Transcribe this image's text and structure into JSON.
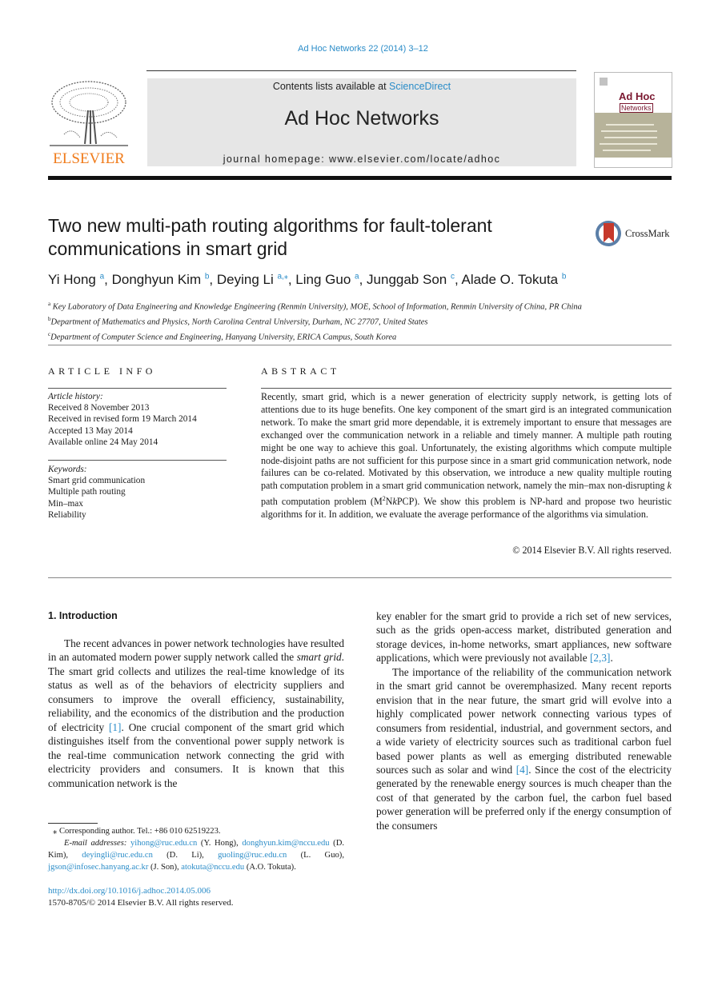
{
  "header": {
    "journal_ref": "Ad Hoc Networks 22 (2014) 3–12",
    "contents_prefix": "Contents lists available at ",
    "contents_link": "ScienceDirect",
    "journal_title": "Ad Hoc Networks",
    "homepage": "journal homepage: www.elsevier.com/locate/adhoc",
    "publisher_logo": "ELSEVIER",
    "cover_title_line1": "Ad Hoc",
    "cover_title_line2": "Networks",
    "colors": {
      "link": "#2a8cc8",
      "elsevier_orange": "#f07c1c",
      "masthead_bg": "#e6e6e6"
    }
  },
  "article": {
    "title": "Two new multi-path routing algorithms for fault-tolerant communications in smart grid",
    "crossmark_label": "CrossMark",
    "authors": [
      {
        "name": "Yi Hong",
        "sup": "a",
        "sep": ", "
      },
      {
        "name": "Donghyun Kim",
        "sup": "b",
        "sep": ", "
      },
      {
        "name": "Deying Li",
        "sup": "a,⁎",
        "sep": ", "
      },
      {
        "name": "Ling Guo",
        "sup": "a",
        "sep": ", "
      },
      {
        "name": "Junggab Son",
        "sup": "c",
        "sep": ", "
      },
      {
        "name": "Alade O. Tokuta",
        "sup": "b",
        "sep": ""
      }
    ],
    "affiliations": [
      {
        "sup": "a",
        "text": "Key Laboratory of Data Engineering and Knowledge Engineering (Renmin University), MOE, School of Information, Renmin University of China, PR China"
      },
      {
        "sup": "b",
        "text": "Department of Mathematics and Physics, North Carolina Central University, Durham, NC 27707, United States"
      },
      {
        "sup": "c",
        "text": "Department of Computer Science and Engineering, Hanyang University, ERICA Campus, South Korea"
      }
    ]
  },
  "article_info": {
    "heading": "ARTICLE INFO",
    "history_label": "Article history:",
    "history": [
      "Received 8 November 2013",
      "Received in revised form 19 March 2014",
      "Accepted 13 May 2014",
      "Available online 24 May 2014"
    ],
    "keywords_label": "Keywords:",
    "keywords": [
      "Smart grid communication",
      "Multiple path routing",
      "Min–max",
      "Reliability"
    ]
  },
  "abstract": {
    "heading": "ABSTRACT",
    "text_part1": "Recently, smart grid, which is a newer generation of electricity supply network, is getting lots of attentions due to its huge benefits. One key component of the smart gird is an integrated communication network. To make the smart grid more dependable, it is extremely important to ensure that messages are exchanged over the communication network in a reliable and timely manner. A multiple path routing might be one way to achieve this goal. Unfortunately, the existing algorithms which compute multiple node-disjoint paths are not sufficient for this purpose since in a smart grid communication network, node failures can be co-related. Motivated by this observation, we introduce a new quality multiple routing path computation problem in a smart grid communication network, namely the min–max non-disrupting ",
    "text_k": "k",
    "text_part2": " path computation problem (M",
    "text_sup": "2",
    "text_part3": "N",
    "text_k2": "k",
    "text_part4": "PCP). We show this problem is NP-hard and propose two heuristic algorithms for it. In addition, we evaluate the average performance of the algorithms via simulation.",
    "copyright": "© 2014 Elsevier B.V. All rights reserved."
  },
  "introduction": {
    "heading": "1. Introduction",
    "left_p1_a": "The recent advances in power network technologies have resulted in an automated modern power supply network called the ",
    "left_p1_em": "smart grid",
    "left_p1_b": ". The smart grid collects and utilizes the real-time knowledge of its status as well as of the behaviors of electricity suppliers and consumers to improve the overall efficiency, sustainability, reliability, and the economics of the distribution and the production of electricity ",
    "left_p1_ref": "[1]",
    "left_p1_c": ". One crucial component of the smart grid which distinguishes itself from the conventional power supply network is the real-time communication network connecting the grid with electricity providers and consumers. It is known that this communication network is the",
    "right_p1_a": "key enabler for the smart grid to provide a rich set of new services, such as the grids open-access market, distributed generation and storage devices, in-home networks, smart appliances, new software applications, which were previously not available ",
    "right_p1_ref": "[2,3]",
    "right_p1_b": ".",
    "right_p2_a": "The importance of the reliability of the communication network in the smart grid cannot be overemphasized. Many recent reports envision that in the near future, the smart grid will evolve into a highly complicated power network connecting various types of consumers from residential, industrial, and government sectors, and a wide variety of electricity sources such as traditional carbon fuel based power plants as well as emerging distributed renewable sources such as solar and wind ",
    "right_p2_ref": "[4]",
    "right_p2_b": ". Since the cost of the electricity generated by the renewable energy sources is much cheaper than the cost of that generated by the carbon fuel, the carbon fuel based power generation will be preferred only if the energy consumption of the consumers"
  },
  "footnotes": {
    "corresponding": "⁎ Corresponding author. Tel.: +86 010 62519223.",
    "email_label": "E-mail addresses: ",
    "emails": [
      {
        "email": "yihong@ruc.edu.cn",
        "who": " (Y. Hong), "
      },
      {
        "email": "donghyun.kim@nccu.edu",
        "who": " (D. Kim), "
      },
      {
        "email": "deyingli@ruc.edu.cn",
        "who": " (D. Li), "
      },
      {
        "email": "guoling@ruc.edu.cn",
        "who": " (L. Guo), "
      },
      {
        "email": "jgson@infosec.hanyang.ac.kr",
        "who": " (J. Son), "
      },
      {
        "email": "atokuta@nccu.edu",
        "who": " (A.O. Tokuta)."
      }
    ],
    "doi": "http://dx.doi.org/10.1016/j.adhoc.2014.05.006",
    "issn": "1570-8705/© 2014 Elsevier B.V. All rights reserved."
  }
}
